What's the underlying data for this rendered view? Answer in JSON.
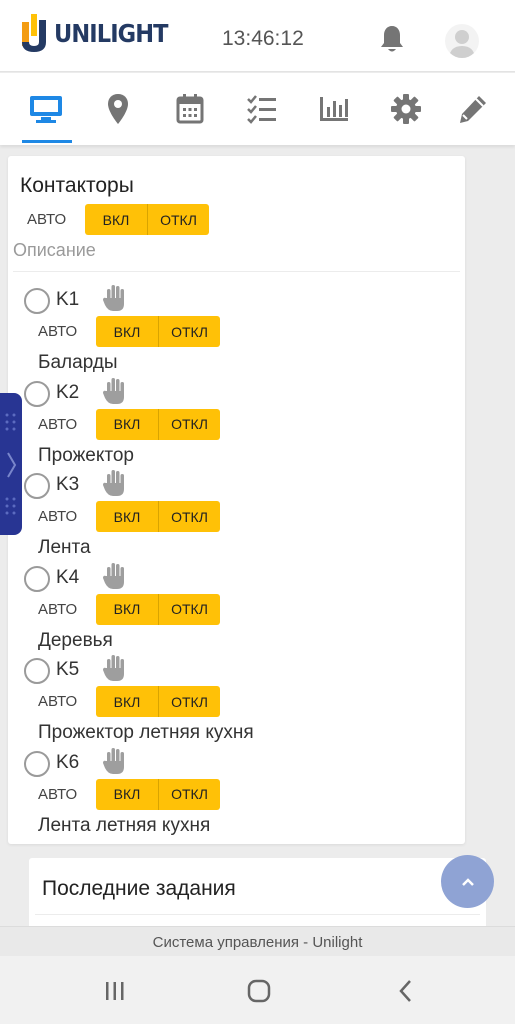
{
  "header": {
    "logo_text": "UNILIGHT",
    "time": "13:46:12",
    "bell_icon": "bell-icon",
    "avatar_icon": "user-avatar-icon"
  },
  "tabs": [
    {
      "icon": "monitor-icon",
      "active": true
    },
    {
      "icon": "map-pin-icon",
      "active": false
    },
    {
      "icon": "calendar-icon",
      "active": false
    },
    {
      "icon": "checklist-icon",
      "active": false
    },
    {
      "icon": "bar-chart-icon",
      "active": false
    },
    {
      "icon": "gear-icon",
      "active": false
    },
    {
      "icon": "pencil-icon",
      "active": false
    }
  ],
  "contactors": {
    "title": "Контакторы",
    "auto_label": "АВТО",
    "on_label": "ВКЛ",
    "off_label": "ОТКЛ",
    "description_label": "Описание",
    "items": [
      {
        "id": "K1",
        "name": "Баларды"
      },
      {
        "id": "K2",
        "name": "Прожектор"
      },
      {
        "id": "K3",
        "name": "Лента"
      },
      {
        "id": "K4",
        "name": "Деревья"
      },
      {
        "id": "K5",
        "name": "Прожектор летняя кухня"
      },
      {
        "id": "K6",
        "name": "Лента летняя кухня"
      }
    ]
  },
  "last_tasks": {
    "title": "Последние задания"
  },
  "footer": {
    "text": "Система управления - Unilight"
  },
  "colors": {
    "accent": "#ffc107",
    "brand": "#243a63",
    "tab_active": "#1e88e5",
    "side_handle": "#283593"
  }
}
